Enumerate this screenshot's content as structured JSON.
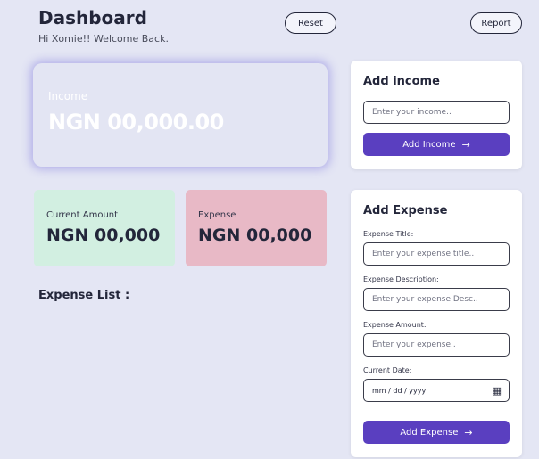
{
  "header": {
    "title": "Dashboard",
    "subtitle": "Hi Xomie!! Welcome Back.",
    "reset_label": "Reset",
    "report_label": "Report"
  },
  "income_card": {
    "label": "Income",
    "value": "NGN 00,000.00"
  },
  "current_card": {
    "label": "Current Amount",
    "value": "NGN 00,000",
    "color": "#d2efe1"
  },
  "expense_card": {
    "label": "Expense",
    "value": "NGN 00,000",
    "color": "#e8b9c6"
  },
  "expense_list": {
    "title": "Expense List :"
  },
  "add_income": {
    "title": "Add income",
    "placeholder": "Enter your income..",
    "button_label": "Add Income"
  },
  "add_expense": {
    "title": "Add Expense",
    "title_label": "Expense Title:",
    "title_placeholder": "Enter your expense title..",
    "desc_label": "Expense Description:",
    "desc_placeholder": "Enter your expense Desc..",
    "amount_label": "Expense Amount:",
    "amount_placeholder": "Enter your expense..",
    "date_label": "Current Date:",
    "date_value": "mm / dd / yyyy",
    "button_label": "Add Expense"
  },
  "icons": {
    "arrow": "arrow-right-icon",
    "calendar": "calendar-icon"
  },
  "colors": {
    "accent": "#5a3fc0",
    "background": "#e4e6f4"
  }
}
